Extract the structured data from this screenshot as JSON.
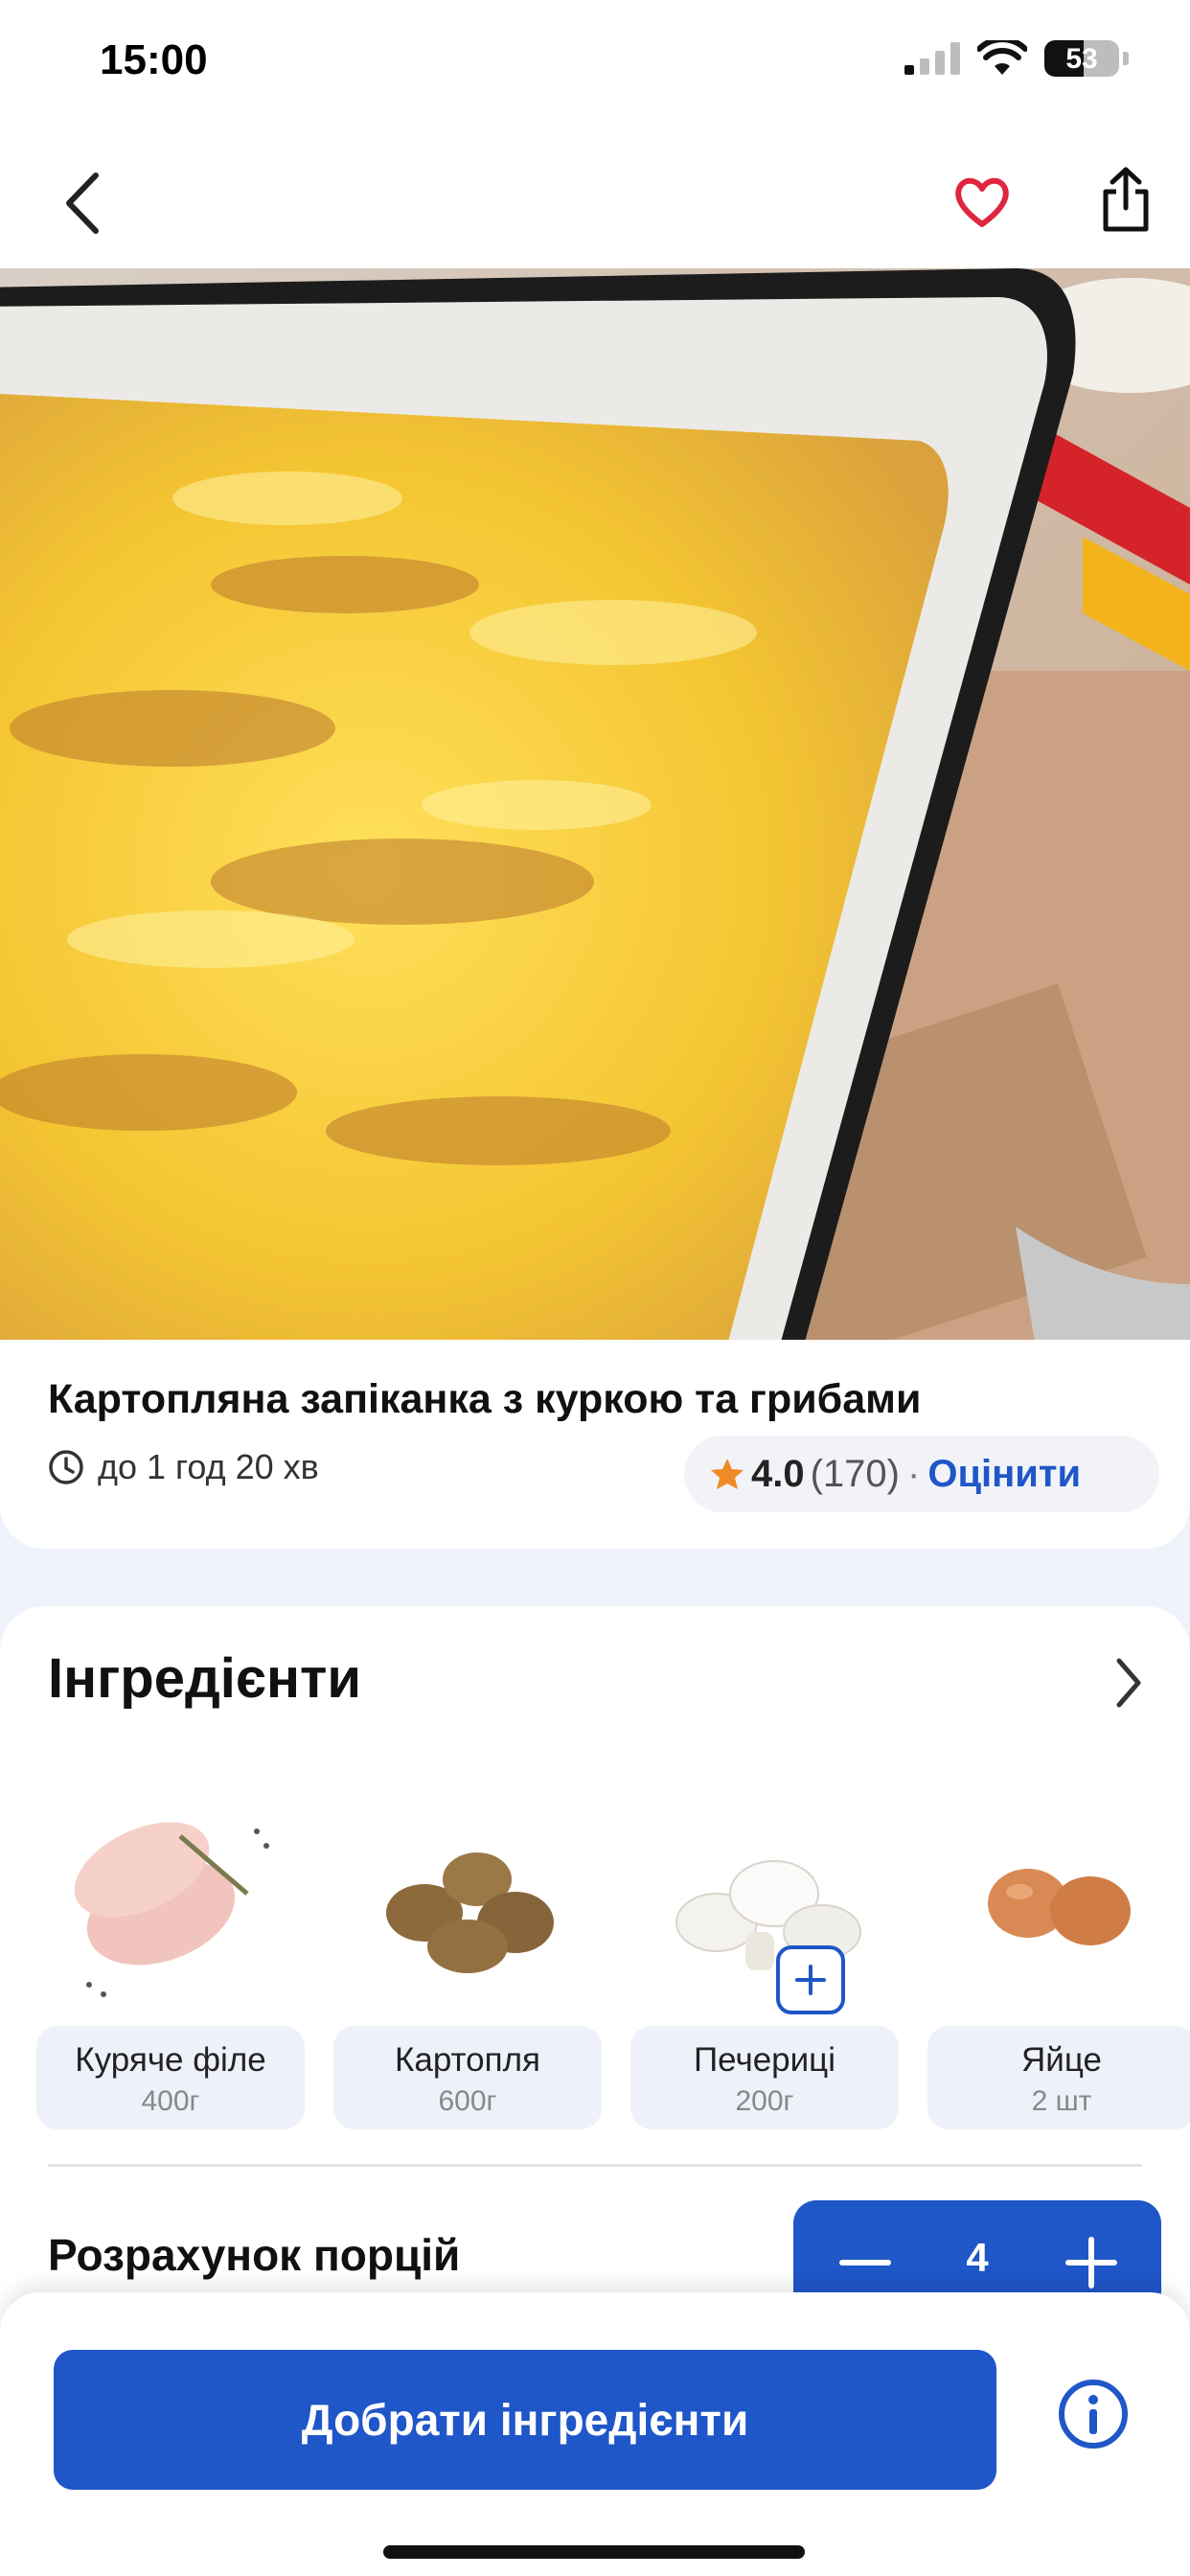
{
  "status_bar": {
    "time": "15:00",
    "battery": "53",
    "battery_level": 0.53
  },
  "recipe": {
    "title": "Картопляна запіканка з куркою та грибами",
    "time": "до 1 год 20 хв",
    "rating": "4.0",
    "rating_count": "(170)",
    "rating_separator": "·",
    "rate_label": "Оцінити"
  },
  "ingredients": {
    "title": "Інгредієнти",
    "items": [
      {
        "name": "Куряче філе",
        "qty": "400г"
      },
      {
        "name": "Картопля",
        "qty": "600г"
      },
      {
        "name": "Печериці",
        "qty": "200г"
      },
      {
        "name": "Яйце",
        "qty": "2 шт"
      }
    ]
  },
  "portions": {
    "label": "Розрахунок порцій",
    "value": "4"
  },
  "bottom": {
    "cta_label": "Добрати інгредієнти"
  },
  "colors": {
    "accent": "#1f56c8",
    "favorite": "#e0263f",
    "star": "#f08a24"
  },
  "icons": [
    "back-icon",
    "heart-icon",
    "share-icon",
    "clock-icon",
    "star-icon",
    "chevron-right-icon",
    "plus-icon",
    "minus-icon",
    "info-icon"
  ]
}
